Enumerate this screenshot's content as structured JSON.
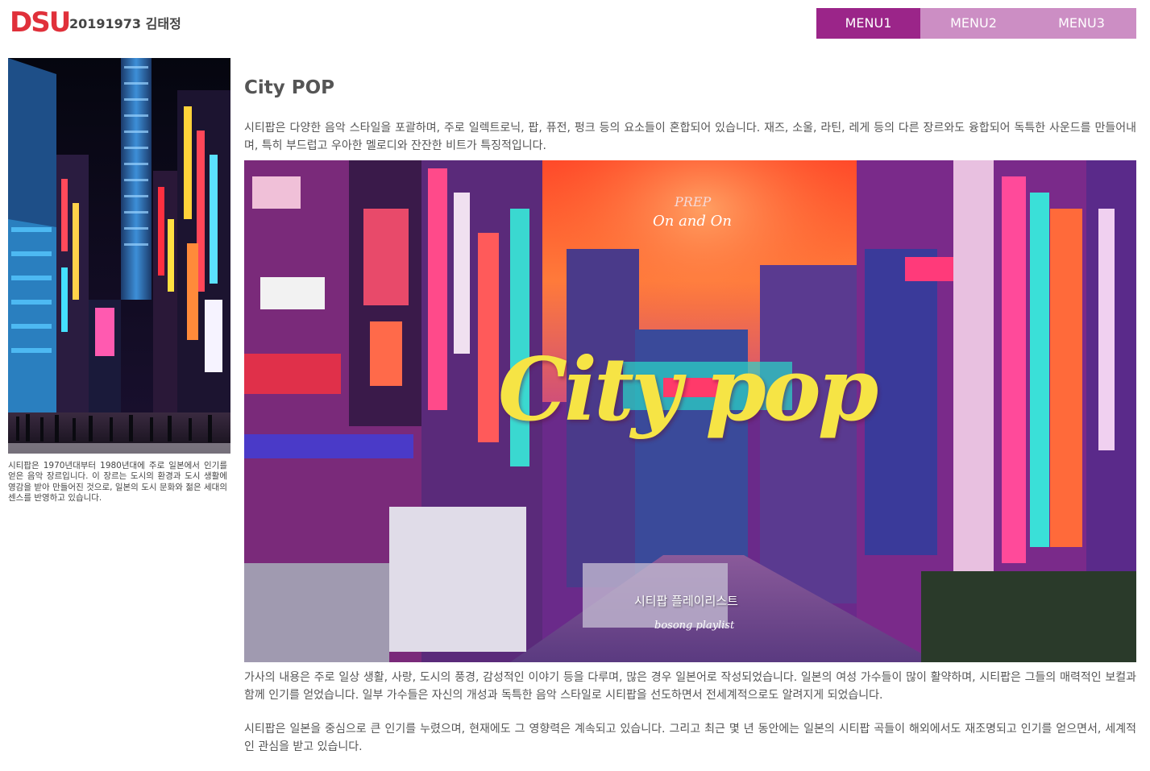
{
  "header": {
    "logo": "DSU",
    "student": "20191973 김태정"
  },
  "menu": {
    "items": [
      {
        "label": "MENU1"
      },
      {
        "label": "MENU2"
      },
      {
        "label": "MENU3"
      }
    ]
  },
  "sidebar": {
    "caption": "시티팝은 1970년대부터 1980년대에 주로 일본에서 인기를 얻은 음악 장르입니다. 이 장르는 도시의 환경과 도시 생활에 영감을 받아 만들어진 것으로, 일본의 도시 문화와 젊은 세대의 센스를 반영하고 있습니다."
  },
  "main": {
    "title": "City POP",
    "paragraph1": "시티팝은 다양한 음악 스타일을 포괄하며, 주로 일렉트로닉, 팝, 퓨전, 펑크 등의 요소들이 혼합되어 있습니다. 재즈, 소울, 라틴, 레게 등의 다른 장르와도 융합되어 독특한 사운드를 만들어내며, 특히 부드럽고 우아한 멜로디와 잔잔한 비트가 특징적입니다.",
    "paragraph2": "가사의 내용은 주로 일상 생활, 사랑, 도시의 풍경, 감성적인 이야기 등을 다루며, 많은 경우 일본어로 작성되었습니다. 일본의 여성 가수들이 많이 활약하며, 시티팝은 그들의 매력적인 보컬과 함께 인기를 얻었습니다. 일부 가수들은 자신의 개성과 독특한 음악 스타일로 시티팝을 선도하면서 전세계적으로도 알려지게 되었습니다.",
    "paragraph3": "시티팝은 일본을 중심으로 큰 인기를 누렸으며, 현재에도 그 영향력은 계속되고 있습니다. 그리고 최근 몇 년 동안에는 일본의 시티팝 곡들이 해외에서도 재조명되고 인기를 얻으면서, 세계적인 관심을 받고 있습니다."
  },
  "hero": {
    "prep": "PREP",
    "subtitle": "On and On",
    "title": "City pop",
    "playlist_ko": "시티팝 플레이리스트",
    "playlist_en": "bosong playlist"
  },
  "colors": {
    "menu_active": "#9b2589",
    "menu_normal": "#cc8ec4",
    "logo": "#e0303a",
    "hero_title": "#f6e445"
  }
}
